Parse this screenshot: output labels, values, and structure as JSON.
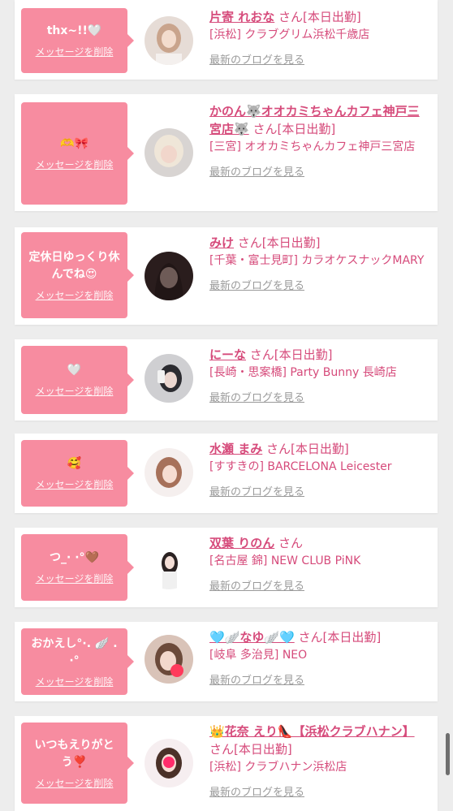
{
  "delete_label": "メッセージを削除",
  "blog_label": "最新のブログを見る",
  "colors": {
    "accent": "#f78ca0",
    "name": "#d64b7b",
    "link_gray": "#9a9a9a"
  },
  "entries": [
    {
      "message": "thx~!!🤍",
      "name": "片寄 れおな",
      "san": " さん",
      "status": "[本日出勤]",
      "shop": "[浜松] クラブグリム浜松千歳店"
    },
    {
      "message": "🫶🎀",
      "name": "かのん🐺オオカミちゃんカフェ神戸三宮店🐺",
      "san": " さん",
      "status": "[本日出勤]",
      "shop": "[三宮] オオカミちゃんカフェ神戸三宮店"
    },
    {
      "message": "定休日ゆっくり休んでね😍",
      "name": "みけ",
      "san": " さん",
      "status": "[本日出勤]",
      "shop": "[千葉・富士見町] カラオケスナックMARY"
    },
    {
      "message": "🤍",
      "name": "にーな",
      "san": " さん",
      "status": "[本日出勤]",
      "shop": "[長崎・思案橋] Party Bunny 長崎店"
    },
    {
      "message": "🥰",
      "name": "水瀬 まみ",
      "san": " さん",
      "status": "[本日出勤]",
      "shop": "[すすきの] BARCELONA Leicester"
    },
    {
      "message": "つ_· ·°🤎",
      "name": "双葉 りのん",
      "san": " さん",
      "status": "",
      "shop": "[名古屋 錦] NEW CLUB PiNK"
    },
    {
      "message": "おかえし°·. 🪽 .·°",
      "name": "🩵🪽なゆ🪽🩵",
      "san": " さん",
      "status": "[本日出勤]",
      "shop": "[岐阜 多治見] NEO"
    },
    {
      "message": "いつもえりがとう❣️",
      "name": "👑花奈 えり👠【浜松クラブハナン】",
      "san": " さん",
      "status": "[本日出勤]",
      "shop": "[浜松] クラブハナン浜松店"
    }
  ]
}
